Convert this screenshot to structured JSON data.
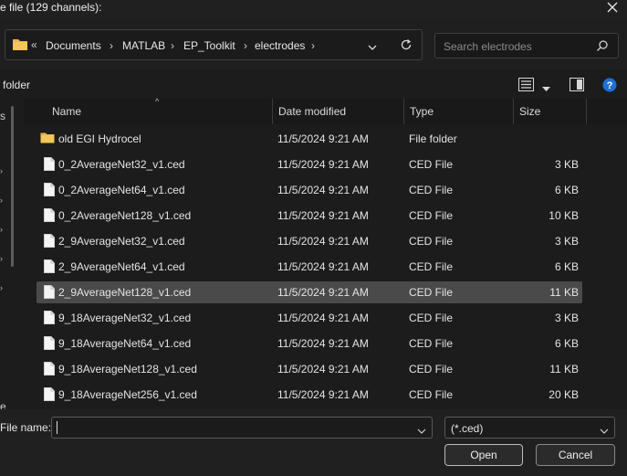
{
  "window": {
    "title": "e file (129 channels):"
  },
  "address": {
    "overflow_glyph": "«",
    "crumbs": [
      "Documents",
      "MATLAB",
      "EP_Toolkit",
      "electrodes"
    ]
  },
  "search": {
    "placeholder": "Search electrodes"
  },
  "toolbar": {
    "new_folder_label": "folder"
  },
  "sidebar": {
    "clipped_glyph": "s",
    "clipped_glyph_2": "e"
  },
  "columns": {
    "name": "Name",
    "date": "Date modified",
    "type": "Type",
    "size": "Size"
  },
  "files": [
    {
      "name": "old EGI Hydrocel",
      "date": "11/5/2024 9:21 AM",
      "type": "File folder",
      "size": "",
      "kind": "folder"
    },
    {
      "name": "0_2AverageNet32_v1.ced",
      "date": "11/5/2024 9:21 AM",
      "type": "CED File",
      "size": "3 KB",
      "kind": "file"
    },
    {
      "name": "0_2AverageNet64_v1.ced",
      "date": "11/5/2024 9:21 AM",
      "type": "CED File",
      "size": "6 KB",
      "kind": "file"
    },
    {
      "name": "0_2AverageNet128_v1.ced",
      "date": "11/5/2024 9:21 AM",
      "type": "CED File",
      "size": "10 KB",
      "kind": "file"
    },
    {
      "name": "2_9AverageNet32_v1.ced",
      "date": "11/5/2024 9:21 AM",
      "type": "CED File",
      "size": "3 KB",
      "kind": "file"
    },
    {
      "name": "2_9AverageNet64_v1.ced",
      "date": "11/5/2024 9:21 AM",
      "type": "CED File",
      "size": "6 KB",
      "kind": "file"
    },
    {
      "name": "2_9AverageNet128_v1.ced",
      "date": "11/5/2024 9:21 AM",
      "type": "CED File",
      "size": "11 KB",
      "kind": "file",
      "selected": true
    },
    {
      "name": "9_18AverageNet32_v1.ced",
      "date": "11/5/2024 9:21 AM",
      "type": "CED File",
      "size": "3 KB",
      "kind": "file"
    },
    {
      "name": "9_18AverageNet64_v1.ced",
      "date": "11/5/2024 9:21 AM",
      "type": "CED File",
      "size": "6 KB",
      "kind": "file"
    },
    {
      "name": "9_18AverageNet128_v1.ced",
      "date": "11/5/2024 9:21 AM",
      "type": "CED File",
      "size": "11 KB",
      "kind": "file"
    },
    {
      "name": "9_18AverageNet256_v1.ced",
      "date": "11/5/2024 9:21 AM",
      "type": "CED File",
      "size": "20 KB",
      "kind": "file"
    }
  ],
  "bottom": {
    "filename_label": "File name:",
    "filename_value": "",
    "filetype_value": "(*.ced)",
    "open_label": "Open",
    "cancel_label": "Cancel"
  },
  "colors": {
    "folder": "#e8b84a",
    "accent_help": "#1f6fd8",
    "selected_row": "#4a4a4a"
  }
}
